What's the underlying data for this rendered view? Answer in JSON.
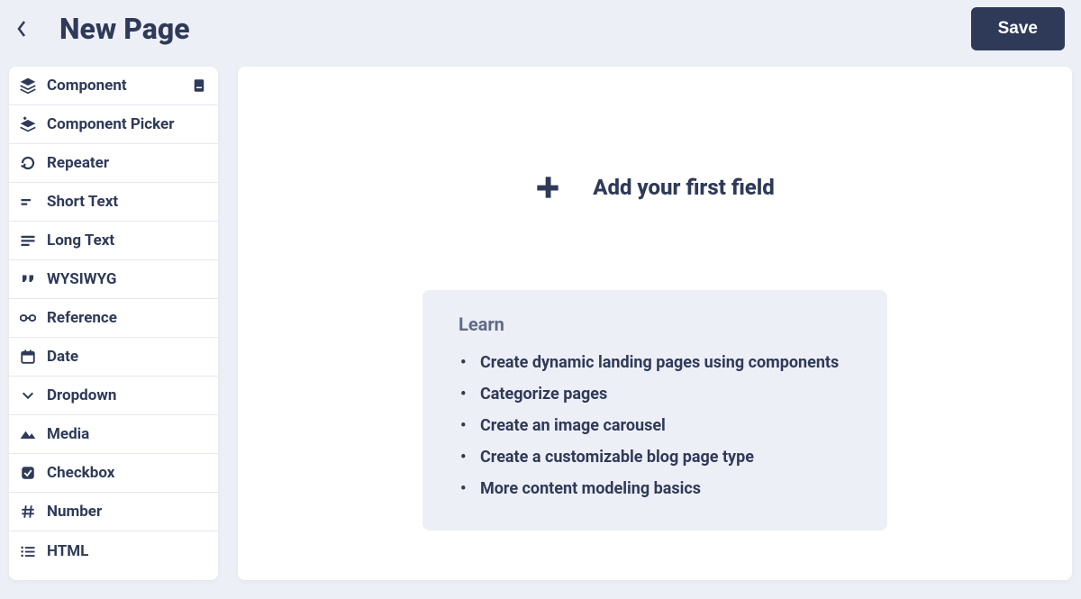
{
  "header": {
    "title": "New Page",
    "save_label": "Save"
  },
  "sidebar": {
    "items": [
      {
        "label": "Component",
        "icon": "layers-icon",
        "badge": true
      },
      {
        "label": "Component Picker",
        "icon": "layers-plus-icon"
      },
      {
        "label": "Repeater",
        "icon": "repeat-icon"
      },
      {
        "label": "Short Text",
        "icon": "short-text-icon"
      },
      {
        "label": "Long Text",
        "icon": "long-text-icon"
      },
      {
        "label": "WYSIWYG",
        "icon": "quote-icon"
      },
      {
        "label": "Reference",
        "icon": "link-icon"
      },
      {
        "label": "Date",
        "icon": "calendar-icon"
      },
      {
        "label": "Dropdown",
        "icon": "chevron-down-icon"
      },
      {
        "label": "Media",
        "icon": "media-icon"
      },
      {
        "label": "Checkbox",
        "icon": "checkbox-icon"
      },
      {
        "label": "Number",
        "icon": "hash-icon"
      },
      {
        "label": "HTML",
        "icon": "list-icon"
      }
    ]
  },
  "main": {
    "add_field_label": "Add your first field",
    "learn": {
      "title": "Learn",
      "links": [
        "Create dynamic landing pages using components",
        "Categorize pages",
        "Create an image carousel",
        "Create a customizable blog page type",
        "More content modeling basics"
      ]
    }
  }
}
